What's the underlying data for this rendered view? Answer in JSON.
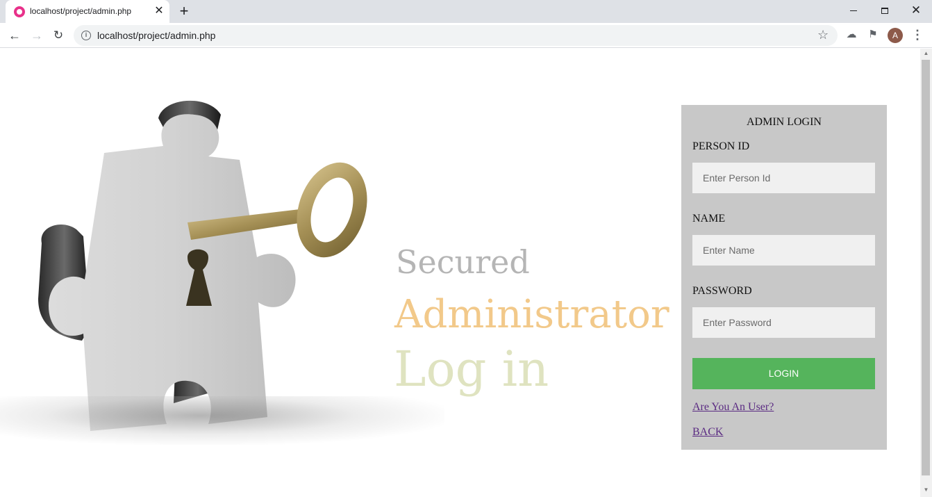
{
  "browser": {
    "tab_title": "localhost/project/admin.php",
    "tab_close": "✕",
    "new_tab": "+",
    "url": "localhost/project/admin.php",
    "window_close": "✕"
  },
  "user": {
    "avatar_initial": "A"
  },
  "hero": {
    "line1": "Secured",
    "line2": "Administrator",
    "line3": "Log in"
  },
  "login": {
    "title": "ADMIN LOGIN",
    "person_id_label": "PERSON ID",
    "person_id_placeholder": "Enter Person Id",
    "name_label": "NAME",
    "name_placeholder": "Enter Name",
    "password_label": "PASSWORD",
    "password_placeholder": "Enter Password",
    "login_button": "LOGIN",
    "user_link": "Are You An User?",
    "back_link": "BACK",
    "button_color": "#55b45c",
    "panel_color": "#c8c8c8"
  }
}
